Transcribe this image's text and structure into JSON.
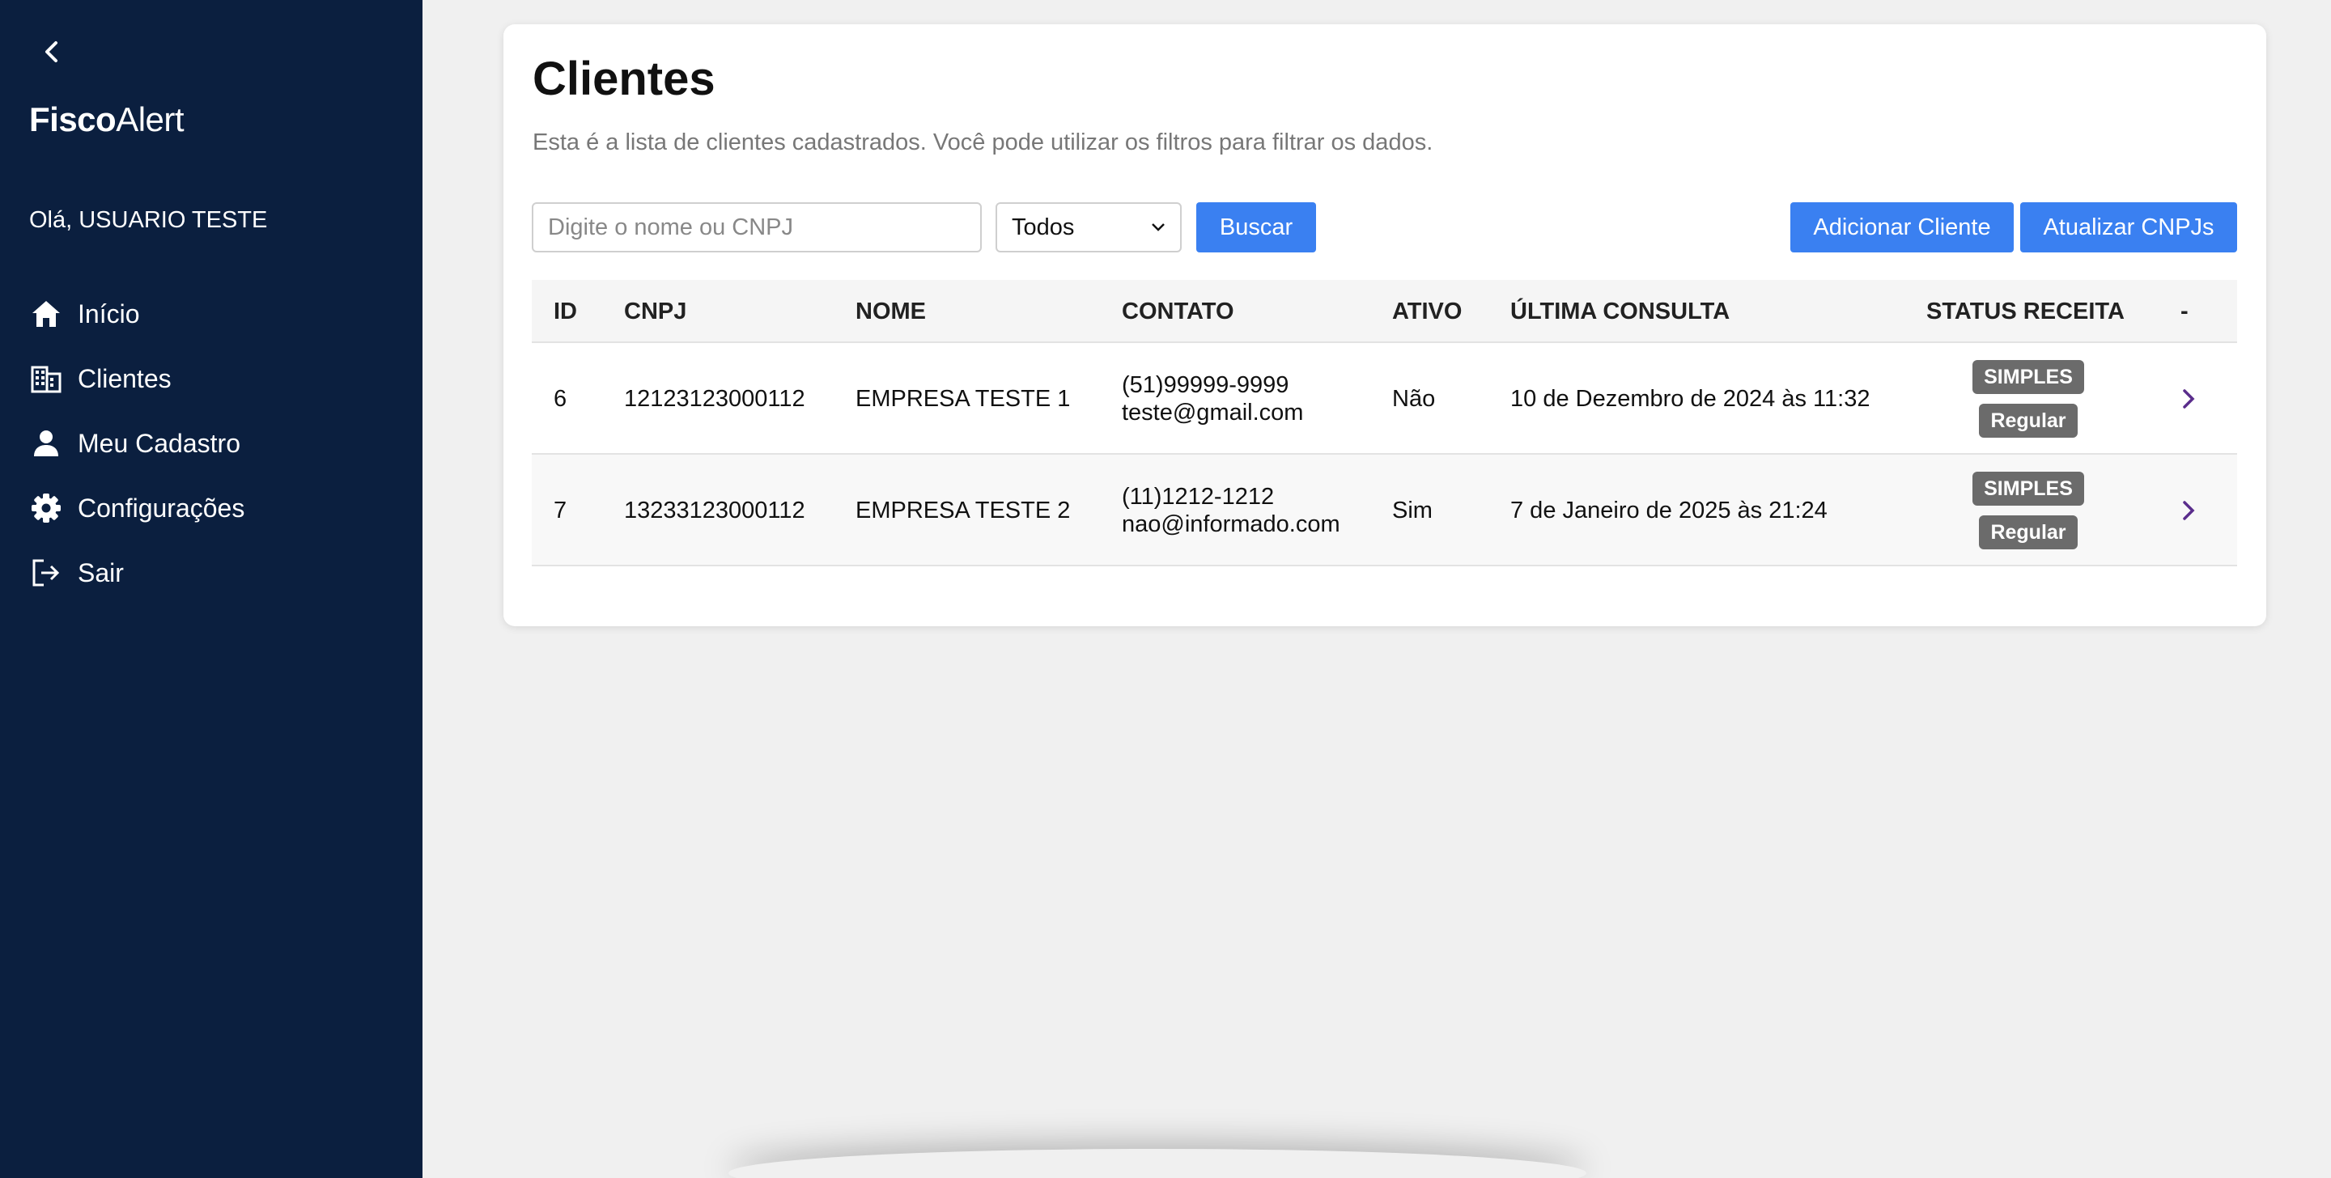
{
  "sidebar": {
    "brand_bold": "Fisco",
    "brand_regular": "Alert",
    "greeting": "Olá, USUARIO TESTE",
    "items": [
      {
        "label": "Início",
        "icon": "home-icon"
      },
      {
        "label": "Clientes",
        "icon": "building-icon"
      },
      {
        "label": "Meu Cadastro",
        "icon": "user-icon"
      },
      {
        "label": "Configurações",
        "icon": "gear-icon"
      },
      {
        "label": "Sair",
        "icon": "logout-icon"
      }
    ]
  },
  "main": {
    "title": "Clientes",
    "subtitle": "Esta é a lista de clientes cadastrados. Você pode utilizar os filtros para filtrar os dados.",
    "search": {
      "placeholder": "Digite o nome ou CNPJ",
      "value": ""
    },
    "filter": {
      "selected": "Todos"
    },
    "buttons": {
      "search": "Buscar",
      "add_client": "Adicionar Cliente",
      "update_cnpjs": "Atualizar CNPJs"
    }
  },
  "table": {
    "headers": [
      "ID",
      "CNPJ",
      "NOME",
      "CONTATO",
      "ATIVO",
      "ÚLTIMA CONSULTA",
      "STATUS RECEITA",
      "-"
    ],
    "rows": [
      {
        "id": "6",
        "cnpj": "12123123000112",
        "nome": "EMPRESA TESTE 1",
        "phone": "(51)99999-9999",
        "email": "teste@gmail.com",
        "ativo": "Não",
        "ultima_consulta": "10 de Dezembro de 2024 às 11:32",
        "regime": "SIMPLES",
        "situacao": "Regular"
      },
      {
        "id": "7",
        "cnpj": "13233123000112",
        "nome": "EMPRESA TESTE 2",
        "phone": "(11)1212-1212",
        "email": "nao@informado.com",
        "ativo": "Sim",
        "ultima_consulta": "7 de Janeiro de 2025 às 21:24",
        "regime": "SIMPLES",
        "situacao": "Regular"
      }
    ]
  },
  "colors": {
    "sidebar_bg": "#0b1f3f",
    "primary_button": "#3a80f1",
    "badge_bg": "#6b6b6b",
    "chevron": "#5a2d8c",
    "page_bg": "#f0f0f0"
  }
}
